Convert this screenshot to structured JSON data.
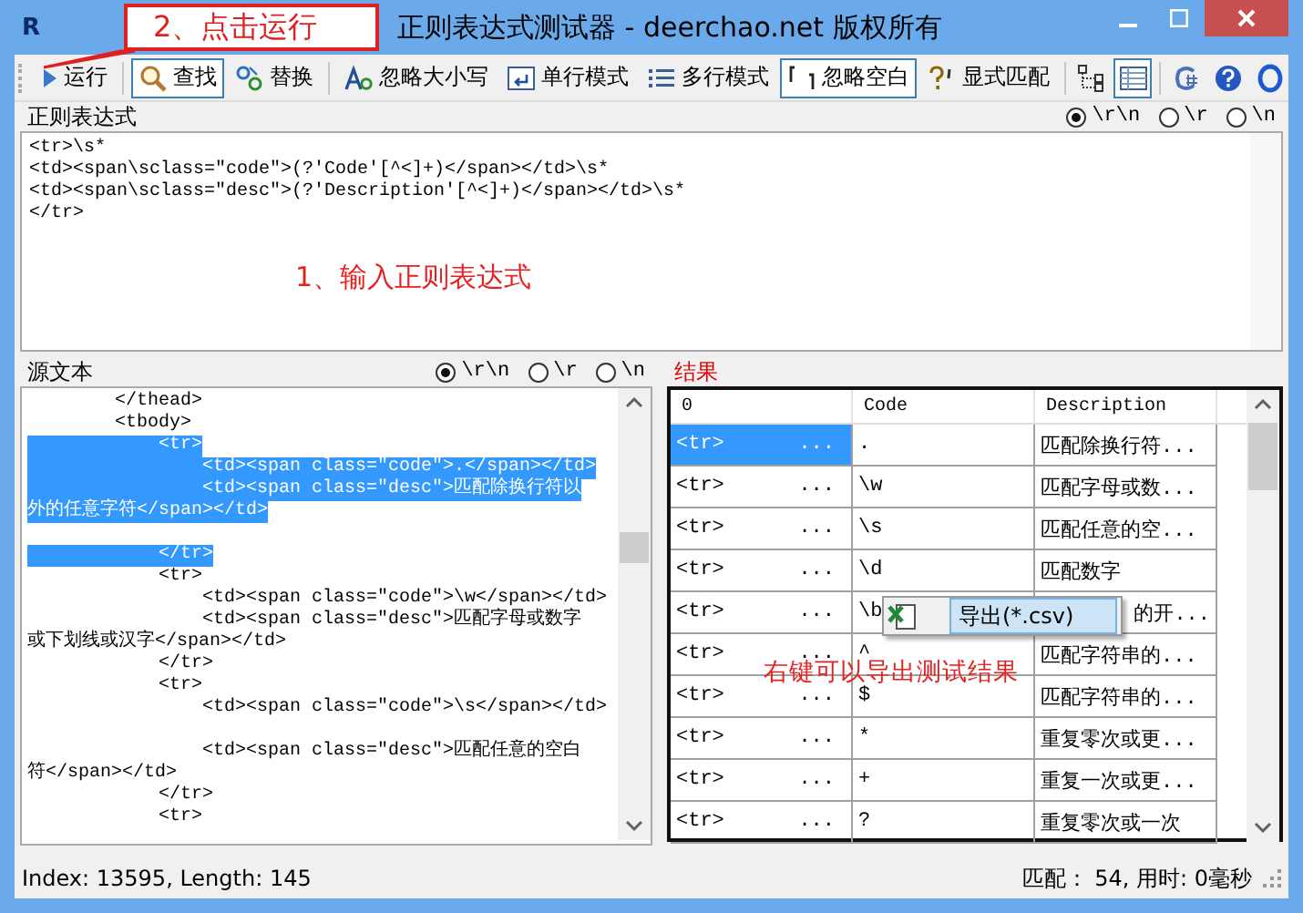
{
  "window": {
    "app_letter": "R",
    "title": "正则表达式测试器 - deerchao.net 版权所有"
  },
  "callout": "2、点击运行",
  "toolbar": {
    "tools": [
      {
        "label": "运行",
        "pressed": false
      },
      {
        "label": "查找",
        "pressed": true
      },
      {
        "label": "替换",
        "pressed": false
      },
      {
        "label": "忽略大小写",
        "pressed": false
      },
      {
        "label": "单行模式",
        "pressed": false
      },
      {
        "label": "多行模式",
        "pressed": false
      },
      {
        "label": "忽略空白",
        "pressed": true
      },
      {
        "label": "显式匹配",
        "pressed": false
      }
    ],
    "icon_tools": [
      {
        "pressed": false
      },
      {
        "pressed": true
      },
      {
        "pressed": false
      },
      {
        "pressed": false
      },
      {
        "pressed": false
      }
    ]
  },
  "regex_panel": {
    "label": "正则表达式",
    "line_endings": [
      {
        "label": "\\r\\n",
        "selected": true
      },
      {
        "label": "\\r",
        "selected": false
      },
      {
        "label": "\\n",
        "selected": false
      }
    ],
    "lines": [
      "<tr>\\s*",
      "<td><span\\sclass=\"code\">(?'Code'[^<]+)</span></td>\\s*",
      "<td><span\\sclass=\"desc\">(?'Description'[^<]+)</span></td>\\s*",
      "</tr>"
    ],
    "annotation": "1、输入正则表达式"
  },
  "source_panel": {
    "label": "源文本",
    "line_endings": [
      {
        "label": "\\r\\n",
        "selected": true
      },
      {
        "label": "\\r",
        "selected": false
      },
      {
        "label": "\\n",
        "selected": false
      }
    ],
    "lines": [
      {
        "text": "        </thead>",
        "selected": false
      },
      {
        "text": "        <tbody>",
        "selected": false
      },
      {
        "text": "            <tr>",
        "selected": true
      },
      {
        "text": "                <td><span class=\"code\">.</span></td>",
        "selected": true
      },
      {
        "text": "                <td><span class=\"desc\">匹配除换行符以",
        "selected": true
      },
      {
        "text": "外的任意字符</span></td>",
        "selected": true
      },
      {
        "text": "            </tr>",
        "selected": true,
        "blank_line_before": true
      },
      {
        "text": "            <tr>",
        "selected": false
      },
      {
        "text": "                <td><span class=\"code\">\\w</span></td>",
        "selected": false
      },
      {
        "text": "                <td><span class=\"desc\">匹配字母或数字",
        "selected": false
      },
      {
        "text": "或下划线或汉字</span></td>",
        "selected": false
      },
      {
        "text": "            </tr>",
        "selected": false
      },
      {
        "text": "            <tr>",
        "selected": false
      },
      {
        "text": "                <td><span class=\"code\">\\s</span></td>",
        "selected": false
      },
      {
        "text": "                <td><span class=\"desc\">匹配任意的空白",
        "selected": false,
        "blank_line_before": true
      },
      {
        "text": "符</span></td>",
        "selected": false
      },
      {
        "text": "            </tr>",
        "selected": false
      },
      {
        "text": "            <tr>",
        "selected": false
      }
    ]
  },
  "results_panel": {
    "label": "结果",
    "columns": [
      "0",
      "Code",
      "Description"
    ],
    "rows": [
      {
        "match": "<tr>",
        "more": "...",
        "code": ".",
        "description": "匹配除换行符...",
        "selected": true
      },
      {
        "match": "<tr>",
        "more": "...",
        "code": "\\w",
        "description": "匹配字母或数...",
        "selected": false
      },
      {
        "match": "<tr>",
        "more": "...",
        "code": "\\s",
        "description": "匹配任意的空...",
        "selected": false
      },
      {
        "match": "<tr>",
        "more": "...",
        "code": "\\d",
        "description": "匹配数字",
        "selected": false
      },
      {
        "match": "<tr>",
        "more": "...",
        "code": "\\b",
        "description": "的开...",
        "selected": false
      },
      {
        "match": "<tr>",
        "more": "...",
        "code": "^",
        "description": "匹配字符串的...",
        "selected": false
      },
      {
        "match": "<tr>",
        "more": "...",
        "code": "$",
        "description": "匹配字符串的...",
        "selected": false
      },
      {
        "match": "<tr>",
        "more": "...",
        "code": "*",
        "description": "重复零次或更...",
        "selected": false
      },
      {
        "match": "<tr>",
        "more": "...",
        "code": "+",
        "description": "重复一次或更...",
        "selected": false
      },
      {
        "match": "<tr>",
        "more": "...",
        "code": "?",
        "description": "重复零次或一次",
        "selected": false
      }
    ],
    "context_menu": {
      "item": "导出(*.csv)"
    },
    "annotation": "右键可以导出测试结果"
  },
  "status_bar": {
    "left": "Index: 13595, Length: 145",
    "right": "匹配： 54, 用时: 0毫秒"
  }
}
